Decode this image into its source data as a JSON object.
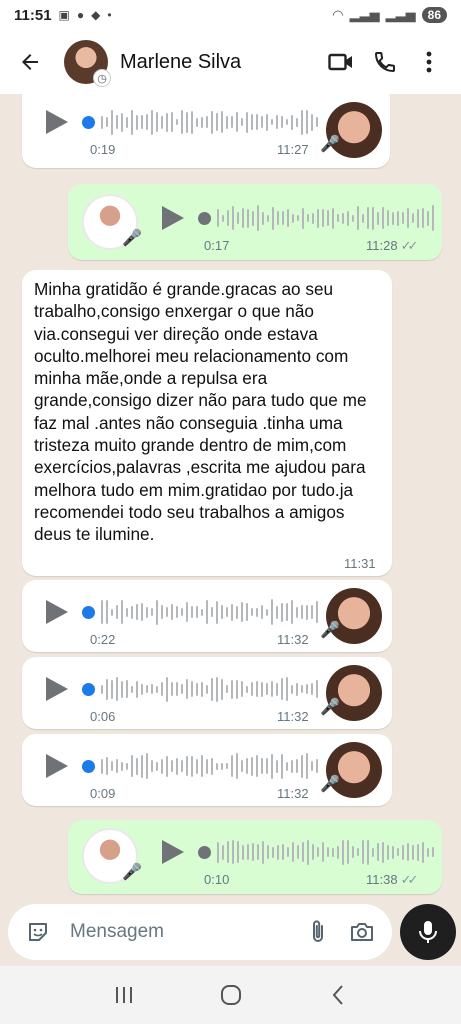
{
  "status_bar": {
    "time": "11:51",
    "battery": "86"
  },
  "header": {
    "contact_name": "Marlene Silva",
    "back_icon": "arrow-left-icon",
    "video_icon": "video-call-icon",
    "call_icon": "phone-icon",
    "menu_icon": "more-vertical-icon"
  },
  "messages": [
    {
      "type": "audio",
      "direction": "in",
      "duration": "0:19",
      "time": "11:27"
    },
    {
      "type": "audio",
      "direction": "out",
      "duration": "0:17",
      "time": "11:28",
      "status": "read"
    },
    {
      "type": "text",
      "direction": "in",
      "text": "Minha gratidão é grande.gracas ao seu trabalho,consigo enxergar o que não via.consegui ver direção onde estava oculto.melhorei meu relacionamento com minha mãe,onde a repulsa era grande,consigo dizer não para tudo que me faz mal .antes não conseguia .tinha uma tristeza muito grande dentro de mim,com exercícios,palavras ,escrita me ajudou para melhora tudo em mim.gratidao por tudo.ja recomendei todo seu trabalhos a amigos deus te ilumine.",
      "time": "11:31"
    },
    {
      "type": "audio",
      "direction": "in",
      "duration": "0:22",
      "time": "11:32"
    },
    {
      "type": "audio",
      "direction": "in",
      "duration": "0:06",
      "time": "11:32"
    },
    {
      "type": "audio",
      "direction": "in",
      "duration": "0:09",
      "time": "11:32"
    },
    {
      "type": "audio",
      "direction": "out",
      "duration": "0:10",
      "time": "11:38",
      "status": "read"
    }
  ],
  "input": {
    "placeholder": "Mensagem",
    "sticker_icon": "sticker-icon",
    "attach_icon": "paperclip-icon",
    "camera_icon": "camera-icon",
    "mic_icon": "microphone-icon"
  },
  "nav": {
    "recents_icon": "recents-icon",
    "home_icon": "home-icon",
    "back_icon": "back-chevron-icon"
  },
  "colors": {
    "incoming_bubble": "#ffffff",
    "outgoing_bubble": "#d9fdd3",
    "chat_background": "#efe7dd",
    "progress_blue": "#1d7ae9"
  }
}
